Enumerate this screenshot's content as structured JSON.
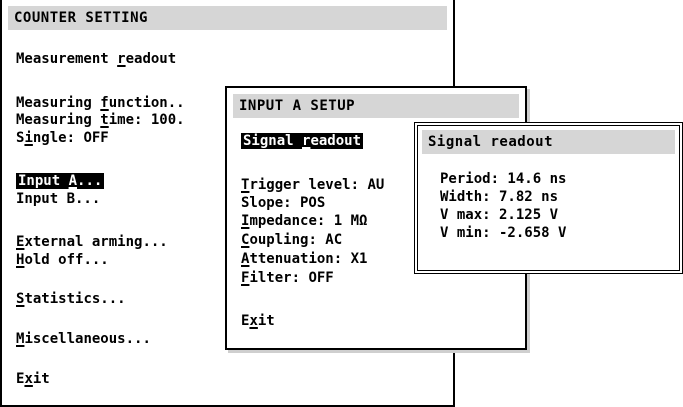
{
  "counter_setting": {
    "title": "COUNTER SETTING",
    "items": {
      "measurement_readout": {
        "pre": "Measurement ",
        "hot": "r",
        "post": "eadout"
      },
      "measuring_function": {
        "pre": "Measuring ",
        "hot": "f",
        "post": "unction.."
      },
      "measuring_time": {
        "pre": "Measuring ",
        "hot": "t",
        "post": "ime: 100."
      },
      "single": {
        "pre": "S",
        "hot": "i",
        "post": "ngle: OFF"
      },
      "input_a": {
        "pre": "Input ",
        "hot": "A",
        "post": "..."
      },
      "input_b": {
        "text": "Input B..."
      },
      "external_arming": {
        "pre": "",
        "hot": "E",
        "post": "xternal arming..."
      },
      "hold_off": {
        "pre": "",
        "hot": "H",
        "post": "old off..."
      },
      "statistics": {
        "pre": "",
        "hot": "S",
        "post": "tatistics..."
      },
      "miscellaneous": {
        "pre": "",
        "hot": "M",
        "post": "iscellaneous..."
      },
      "exit": {
        "pre": "E",
        "hot": "x",
        "post": "it"
      }
    }
  },
  "input_a_setup": {
    "title": "INPUT A SETUP",
    "items": {
      "signal_readout": {
        "pre": "Signal ",
        "hot": "r",
        "post": "eadout"
      },
      "trigger_level": {
        "pre": "",
        "hot": "T",
        "post": "rigger level: AU"
      },
      "slope": {
        "text": "Slope: POS"
      },
      "impedance": {
        "pre": "",
        "hot": "I",
        "post": "mpedance: 1 MΩ"
      },
      "coupling": {
        "pre": "",
        "hot": "C",
        "post": "oupling: AC"
      },
      "attenuation": {
        "pre": "",
        "hot": "A",
        "post": "ttenuation: X1"
      },
      "filter": {
        "pre": "",
        "hot": "F",
        "post": "ilter: OFF"
      },
      "exit": {
        "pre": "E",
        "hot": "x",
        "post": "it"
      }
    }
  },
  "signal_readout": {
    "title": "Signal readout",
    "period": "Period: 14.6 ns",
    "width": "Width:  7.82 ns",
    "vmax": "V max:  2.125 V",
    "vmin": "V min: -2.658 V"
  },
  "colors": {
    "titlebar": "#d6d6d6",
    "selection": "#000000",
    "background": "#ffffff"
  }
}
